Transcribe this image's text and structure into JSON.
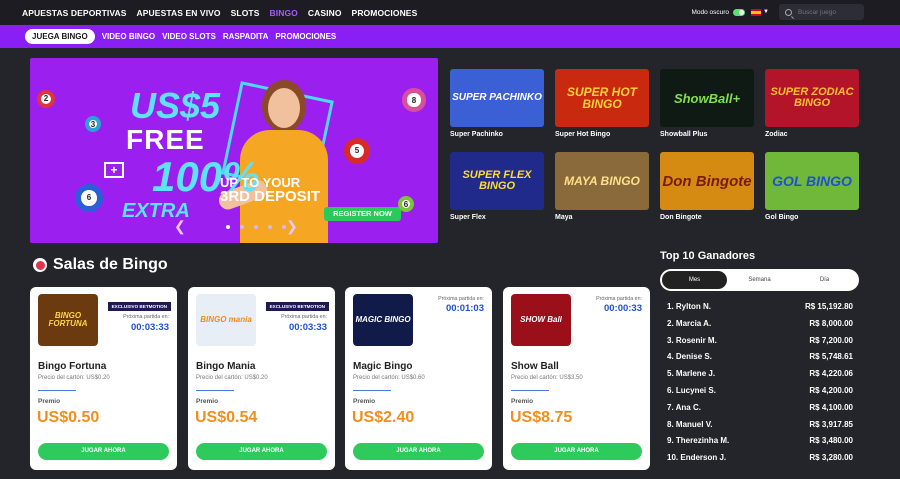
{
  "top_nav": {
    "items": [
      "APUESTAS DEPORTIVAS",
      "APUESTAS EN VIVO",
      "SLOTS",
      "BINGO",
      "CASINO",
      "PROMOCIONES"
    ],
    "active": "BINGO",
    "dark_mode_label": "Modo oscuro",
    "search_placeholder": "Buscar juego"
  },
  "sub_nav": {
    "items": [
      "JUEGA BINGO",
      "VIDEO BINGO",
      "VIDEO SLOTS",
      "RASPADITA",
      "PROMOCIONES"
    ],
    "active": "JUEGA BINGO"
  },
  "hero": {
    "line1": "US$5",
    "line2": "FREE",
    "line3": "100%",
    "line4": "EXTRA",
    "line5": "UP TO YOUR",
    "line6": "3RD DEPOSIT",
    "register_label": "REGISTER NOW",
    "balls": [
      "2",
      "8",
      "5",
      "3",
      "6",
      "6"
    ]
  },
  "games": [
    {
      "name": "Super Pachinko",
      "thumb_text": "SUPER PACHINKO",
      "bg": "#3b5fd4",
      "fg": "#ffffff"
    },
    {
      "name": "Super Hot Bingo",
      "thumb_text": "SUPER HOT BINGO",
      "bg": "#c92a0f",
      "fg": "#ffd23d"
    },
    {
      "name": "Showball Plus",
      "thumb_text": "ShowBall+",
      "bg": "#0f1a14",
      "fg": "#7fe04a"
    },
    {
      "name": "Zodiac",
      "thumb_text": "SUPER ZODIAC BINGO",
      "bg": "#b3142a",
      "fg": "#ffc233"
    },
    {
      "name": "Super Flex",
      "thumb_text": "SUPER FLEX BINGO",
      "bg": "#1f2a8a",
      "fg": "#ffdc2e"
    },
    {
      "name": "Maya",
      "thumb_text": "MAYA BINGO",
      "bg": "#8a6a3a",
      "fg": "#ffe08a"
    },
    {
      "name": "Don Bingote",
      "thumb_text": "Don Bingote",
      "bg": "#d58a12",
      "fg": "#7a1a0a"
    },
    {
      "name": "Gol Bingo",
      "thumb_text": "GOL BINGO",
      "bg": "#6fb83a",
      "fg": "#1f4fd6"
    }
  ],
  "salas": {
    "title": "Salas de Bingo",
    "rooms": [
      {
        "name": "Bingo Fortuna",
        "image_text": "BINGO FORTUNA",
        "img_bg": "#6b3a0f",
        "img_fg": "#ffd34a",
        "exclusive": "EXCLUSIVO BETMOTION",
        "next_label": "Próxima partida en:",
        "timer": "00:03:33",
        "price": "Precio del cartón: US$0.20",
        "prize_label": "Premio",
        "prize": "US$0.50",
        "play_label": "JUGAR AHORA"
      },
      {
        "name": "Bingo Mania",
        "image_text": "BINGO mania",
        "img_bg": "#e8eef5",
        "img_fg": "#f08a1c",
        "exclusive": "EXCLUSIVO BETMOTION",
        "next_label": "Próxima partida en:",
        "timer": "00:03:33",
        "price": "Precio del cartón: US$0.20",
        "prize_label": "Premio",
        "prize": "US$0.54",
        "play_label": "JUGAR AHORA"
      },
      {
        "name": "Magic Bingo",
        "image_text": "MAGIC BINGO",
        "img_bg": "#101b4a",
        "img_fg": "#ffffff",
        "exclusive": "",
        "next_label": "Próxima partida en:",
        "timer": "00:01:03",
        "price": "Precio del cartón: US$0.60",
        "prize_label": "Premio",
        "prize": "US$2.40",
        "play_label": "JUGAR AHORA"
      },
      {
        "name": "Show Ball",
        "image_text": "SHOW Ball",
        "img_bg": "#9a0f1a",
        "img_fg": "#ffffff",
        "exclusive": "",
        "next_label": "Próxima partida en:",
        "timer": "00:00:33",
        "price": "Precio del cartón: US$3.50",
        "prize_label": "Premio",
        "prize": "US$8.75",
        "play_label": "JUGAR AHORA"
      }
    ]
  },
  "top10": {
    "title": "Top 10 Ganadores",
    "tabs": [
      "Mes",
      "Semana",
      "Día"
    ],
    "active_tab": "Mes",
    "winners": [
      {
        "rank": "1.",
        "name": "Rylton N.",
        "amount": "R$ 15,192.80"
      },
      {
        "rank": "2.",
        "name": "Marcia A.",
        "amount": "R$ 8,000.00"
      },
      {
        "rank": "3.",
        "name": "Rosenir M.",
        "amount": "R$ 7,200.00"
      },
      {
        "rank": "4.",
        "name": "Denise S.",
        "amount": "R$ 5,748.61"
      },
      {
        "rank": "5.",
        "name": "Marlene J.",
        "amount": "R$ 4,220.06"
      },
      {
        "rank": "6.",
        "name": "Lucynei S.",
        "amount": "R$ 4,200.00"
      },
      {
        "rank": "7.",
        "name": "Ana C.",
        "amount": "R$ 4,100.00"
      },
      {
        "rank": "8.",
        "name": "Manuel V.",
        "amount": "R$ 3,917.85"
      },
      {
        "rank": "9.",
        "name": "Therezinha M.",
        "amount": "R$ 3,480.00"
      },
      {
        "rank": "10.",
        "name": "Enderson J.",
        "amount": "R$ 3,280.00"
      }
    ]
  }
}
